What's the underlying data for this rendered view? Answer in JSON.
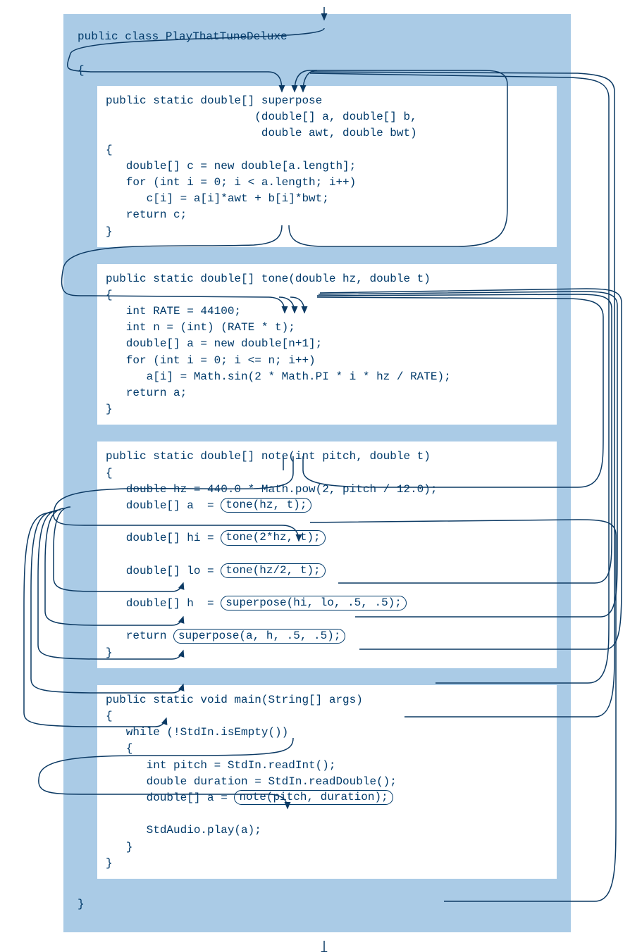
{
  "classDecl": "public class PlayThatTuneDeluxe",
  "openBrace": "{",
  "closeBrace": "}",
  "superpose": {
    "sig1": "public static double[] superpose",
    "sig2": "                      (double[] a, double[] b,",
    "sig3": "                       double awt, double bwt)",
    "open": "{",
    "l1": "   double[] c = new double[a.length];",
    "l2": "   for (int i = 0; i < a.length; i++)",
    "l3": "      c[i] = a[i]*awt + b[i]*bwt;",
    "l4": "   return c;",
    "close": "}"
  },
  "tone": {
    "sig": "public static double[] tone(double hz, double t)",
    "open": "{",
    "l1": "   int RATE = 44100;",
    "l2": "   int n = (int) (RATE * t);",
    "l3": "   double[] a = new double[n+1];",
    "l4": "   for (int i = 0; i <= n; i++)",
    "l5": "      a[i] = Math.sin(2 * Math.PI * i * hz / RATE);",
    "l6": "   return a;",
    "close": "}"
  },
  "note": {
    "sig": "public static double[] note(int pitch, double t)",
    "open": "{",
    "l1": "   double hz = 440.0 * Math.pow(2, pitch / 12.0);",
    "l2a": "   double[] a  = ",
    "l2b": "tone(hz, t);",
    "l3a": "   double[] hi = ",
    "l3b": "tone(2*hz, t);",
    "l4a": "   double[] lo = ",
    "l4b": "tone(hz/2, t);",
    "l5a": "   double[] h  = ",
    "l5b": "superpose(hi, lo, .5, .5);",
    "l6a": "   return ",
    "l6b": "superpose(a, h, .5, .5);",
    "close": "}"
  },
  "main": {
    "sig": "public static void main(String[] args)",
    "open": "{",
    "l1": "   while (!StdIn.isEmpty())",
    "l2": "   {",
    "l3": "      int pitch = StdIn.readInt();",
    "l4": "      double duration = StdIn.readDouble();",
    "l5a": "      double[] a = ",
    "l5b": "note(pitch, duration);",
    "l6": "      StdAudio.play(a);",
    "l7": "   }",
    "close": "}"
  }
}
